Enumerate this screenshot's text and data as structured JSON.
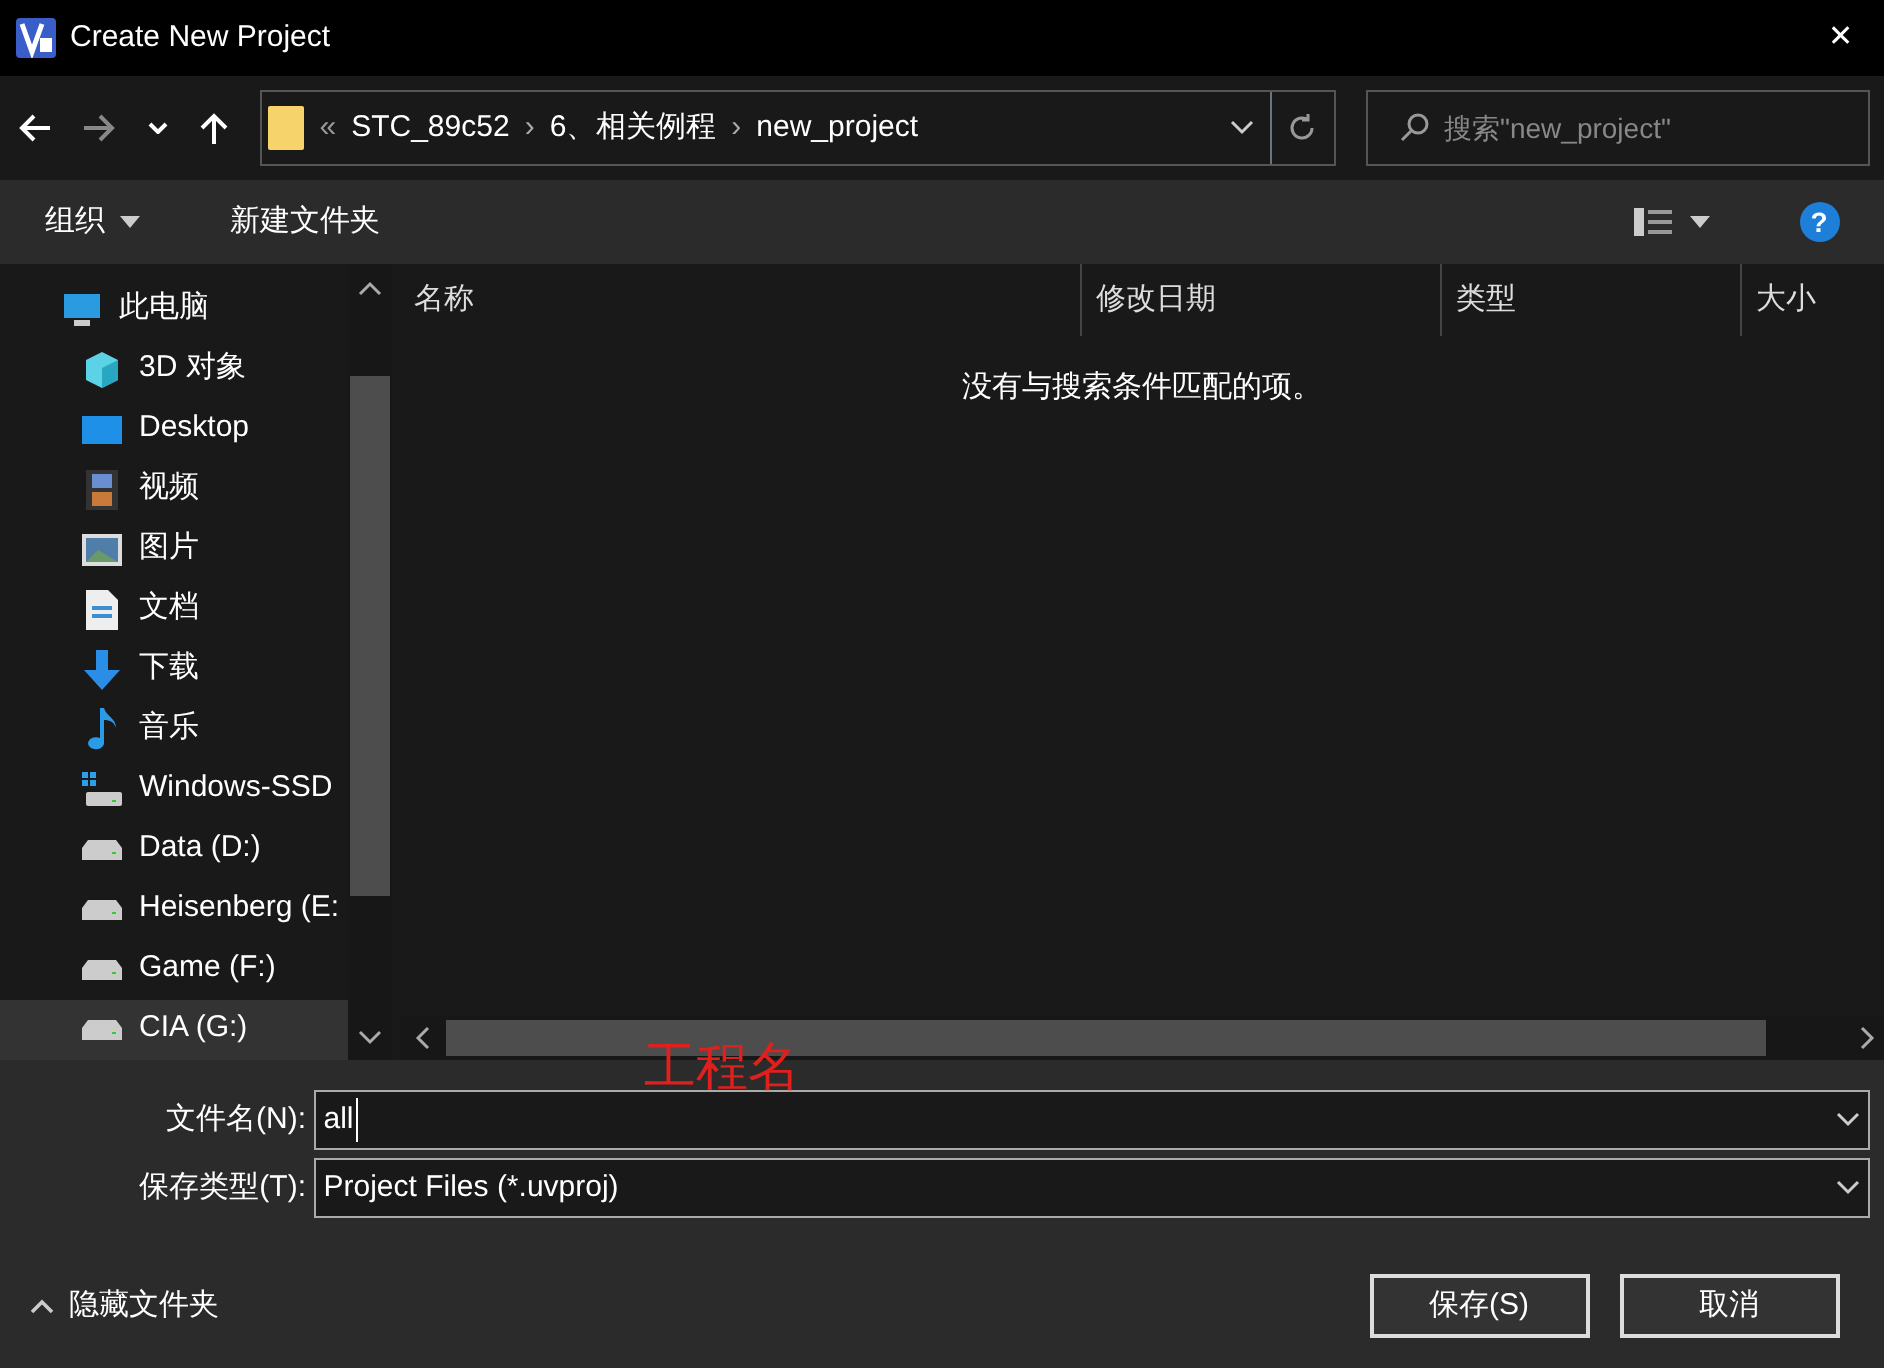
{
  "window": {
    "title": "Create New Project",
    "close": "✕"
  },
  "address_bar": {
    "breadcrumbs": [
      "«",
      "STC_89c52",
      "6、相关例程",
      "new_project"
    ],
    "separators": [
      "›",
      "›"
    ]
  },
  "search": {
    "placeholder": "搜索\"new_project\""
  },
  "toolbar": {
    "organize": "组织",
    "new_folder": "新建文件夹",
    "help": "?"
  },
  "sidebar": {
    "items": [
      {
        "label": "此电脑",
        "kind": "pc",
        "selected": false
      },
      {
        "label": "3D 对象",
        "kind": "cube",
        "selected": false
      },
      {
        "label": "Desktop",
        "kind": "desktop",
        "selected": false
      },
      {
        "label": "视频",
        "kind": "video",
        "selected": false
      },
      {
        "label": "图片",
        "kind": "pictures",
        "selected": false
      },
      {
        "label": "文档",
        "kind": "document",
        "selected": false
      },
      {
        "label": "下载",
        "kind": "download",
        "selected": false
      },
      {
        "label": "音乐",
        "kind": "music",
        "selected": false
      },
      {
        "label": "Windows-SSD",
        "kind": "osdrive",
        "selected": false
      },
      {
        "label": "Data (D:)",
        "kind": "drive",
        "selected": false
      },
      {
        "label": "Heisenberg (E:",
        "kind": "drive",
        "selected": false
      },
      {
        "label": "Game (F:)",
        "kind": "drive",
        "selected": false
      },
      {
        "label": "CIA (G:)",
        "kind": "drive",
        "selected": true
      }
    ]
  },
  "file_list": {
    "columns": [
      "名称",
      "修改日期",
      "类型",
      "大小"
    ],
    "empty_message": "没有与搜索条件匹配的项。"
  },
  "annotation": "工程名",
  "form": {
    "filename_label": "文件名(N):",
    "filename_value": "all",
    "type_label": "保存类型(T):",
    "type_value": "Project Files (*.uvproj)"
  },
  "footer": {
    "hide_folders": "隐藏文件夹",
    "buttons": [
      "保存(S)",
      "取消"
    ]
  }
}
